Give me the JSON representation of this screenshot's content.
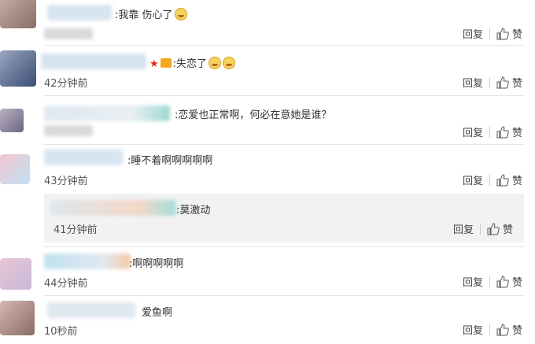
{
  "actions": {
    "reply": "回复",
    "like": "赞"
  },
  "comments": [
    {
      "text": "我靠 伤心了",
      "time": "",
      "emoji_count": 1
    },
    {
      "text": "失恋了",
      "time": "42分钟前",
      "emoji_count": 2
    },
    {
      "text": "恋爱也正常啊，何必在意她是谁？",
      "time": "",
      "emoji_count": 0
    },
    {
      "text": "睡不着啊啊啊啊啊",
      "time": "43分钟前",
      "emoji_count": 0
    },
    {
      "text": "莫激动",
      "time": "41分钟前",
      "emoji_count": 0
    },
    {
      "text": "啊啊啊啊啊",
      "time": "44分钟前",
      "emoji_count": 0
    },
    {
      "text": "爱鱼啊",
      "time": "10秒前",
      "emoji_count": 0
    }
  ],
  "colors": {
    "separator": "#e6e6e6",
    "reply_bg": "#f2f2f5",
    "badge_star": "#e0301e"
  },
  "icons": {
    "like": "thumbs-up-icon",
    "emoji": "crying-face-icon",
    "vip": "star-icon"
  }
}
